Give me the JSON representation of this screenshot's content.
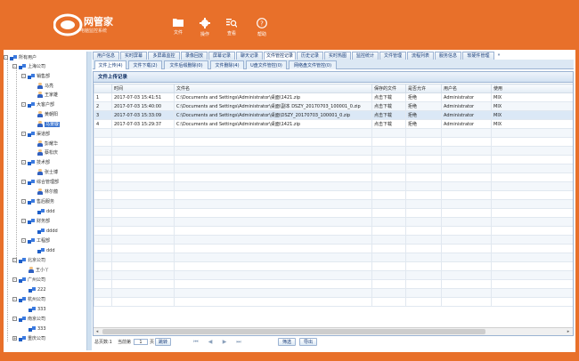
{
  "app": {
    "logo_name": "网管家",
    "logo_sub": "电脑监控系统",
    "toolbar": [
      {
        "label": "文件",
        "icon": "folder-icon"
      },
      {
        "label": "操作",
        "icon": "gear-icon"
      },
      {
        "label": "查看",
        "icon": "view-icon"
      },
      {
        "label": "帮助",
        "icon": "help-icon"
      }
    ]
  },
  "tree": {
    "root": "所有用户",
    "nodes": [
      "上海公司",
      "销售部",
      "马亮",
      "王家雄",
      "大客户部",
      "黄朝阳",
      "马景璇",
      "渠道部",
      "彭耀华",
      "蔡松庆",
      "技术部",
      "张士博",
      "综合管理部",
      "林尔蕴",
      "售后服务",
      "ddd",
      "财务部",
      "dddd",
      "工程部",
      "ddd",
      "北京公司",
      "王小丫",
      "广州公司",
      "222",
      "杭州公司",
      "333",
      "南京公司",
      "333",
      "重庆公司"
    ]
  },
  "tabs_main": [
    "用户信息",
    "实时屏幕",
    "多屏幕监控",
    "录像回放",
    "屏幕记录",
    "聊天记录",
    "文件管控记录",
    "历史记录",
    "实时热图",
    "监控统计",
    "文件管理",
    "流程列表",
    "服务信息",
    "软硬件管理"
  ],
  "tabs_sub": [
    "文件上传(4)",
    "文件下载(2)",
    "文件后缀删除(0)",
    "文件删除(4)",
    "U盘文件管控(0)",
    "网络盘文件管控(0)"
  ],
  "panel_title": "文件上传记录",
  "table": {
    "columns": [
      "",
      "时间",
      "文件名",
      "保存的文件",
      "是否允许",
      "用户名",
      "使用"
    ],
    "rows": [
      {
        "no": "1",
        "time": "2017-07-03 15:41:51",
        "file": "C:\\Documents and Settings\\Administrator\\桌面\\1421.zip",
        "saved": "点击下载",
        "allowed": "拒绝",
        "user": "Administrator",
        "extra": "MIX"
      },
      {
        "no": "2",
        "time": "2017-07-03 15:40:00",
        "file": "C:\\Documents and Settings\\Administrator\\桌面\\副本 DSZY_20170703_100001_0.zip",
        "saved": "点击下载",
        "allowed": "拒绝",
        "user": "Administrator",
        "extra": "MIX"
      },
      {
        "no": "3",
        "time": "2017-07-03 15:33:09",
        "file": "C:\\Documents and Settings\\Administrator\\桌面\\DSZY_20170703_100001_0.zip",
        "saved": "点击下载",
        "allowed": "拒绝",
        "user": "Administrator",
        "extra": "MIX"
      },
      {
        "no": "4",
        "time": "2017-07-03 15:29:37",
        "file": "C:\\Documents and Settings\\Administrator\\桌面\\1421.zip",
        "saved": "点击下载",
        "allowed": "拒绝",
        "user": "Administrator",
        "extra": "MIX"
      }
    ]
  },
  "pager": {
    "total_label": "总页数:1",
    "current_label": "当前第",
    "current_value": "1",
    "page_suffix": "页",
    "jump_label": "跳转",
    "filter_label": "筛选",
    "export_label": "导出"
  },
  "colors": {
    "header": "#e8702a",
    "tree_group_icon": "#1f5fc8",
    "tab_border": "#9bb3d3"
  }
}
